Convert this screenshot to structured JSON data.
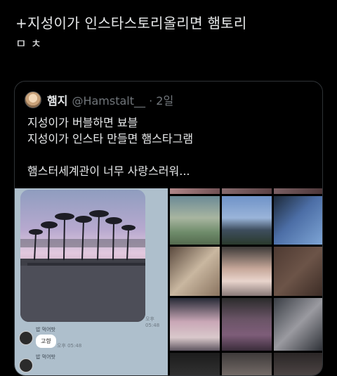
{
  "tweet": {
    "lines": [
      "+지성이가 인스타스토리올리면 햄토리",
      "ㅁ ㅊ"
    ]
  },
  "quote": {
    "name": "햄지",
    "handle": "@Hamstalt__ · 2일",
    "body_lines": [
      "지성이가 버블하면 뵤블",
      "지성이가 인스타 만들면 햄스타그램",
      "",
      "햄스터세계관이 너무 사랑스러워..."
    ]
  },
  "chat": {
    "photo_time": "오후 05:48",
    "sender1": "밥 먹어밧",
    "reply": "고향",
    "reply_time": "오후 05:48",
    "sender2": "밥 먹어밧"
  },
  "icons": {
    "avatar": "profile-avatar",
    "chat_avatar": "chat-avatar"
  }
}
